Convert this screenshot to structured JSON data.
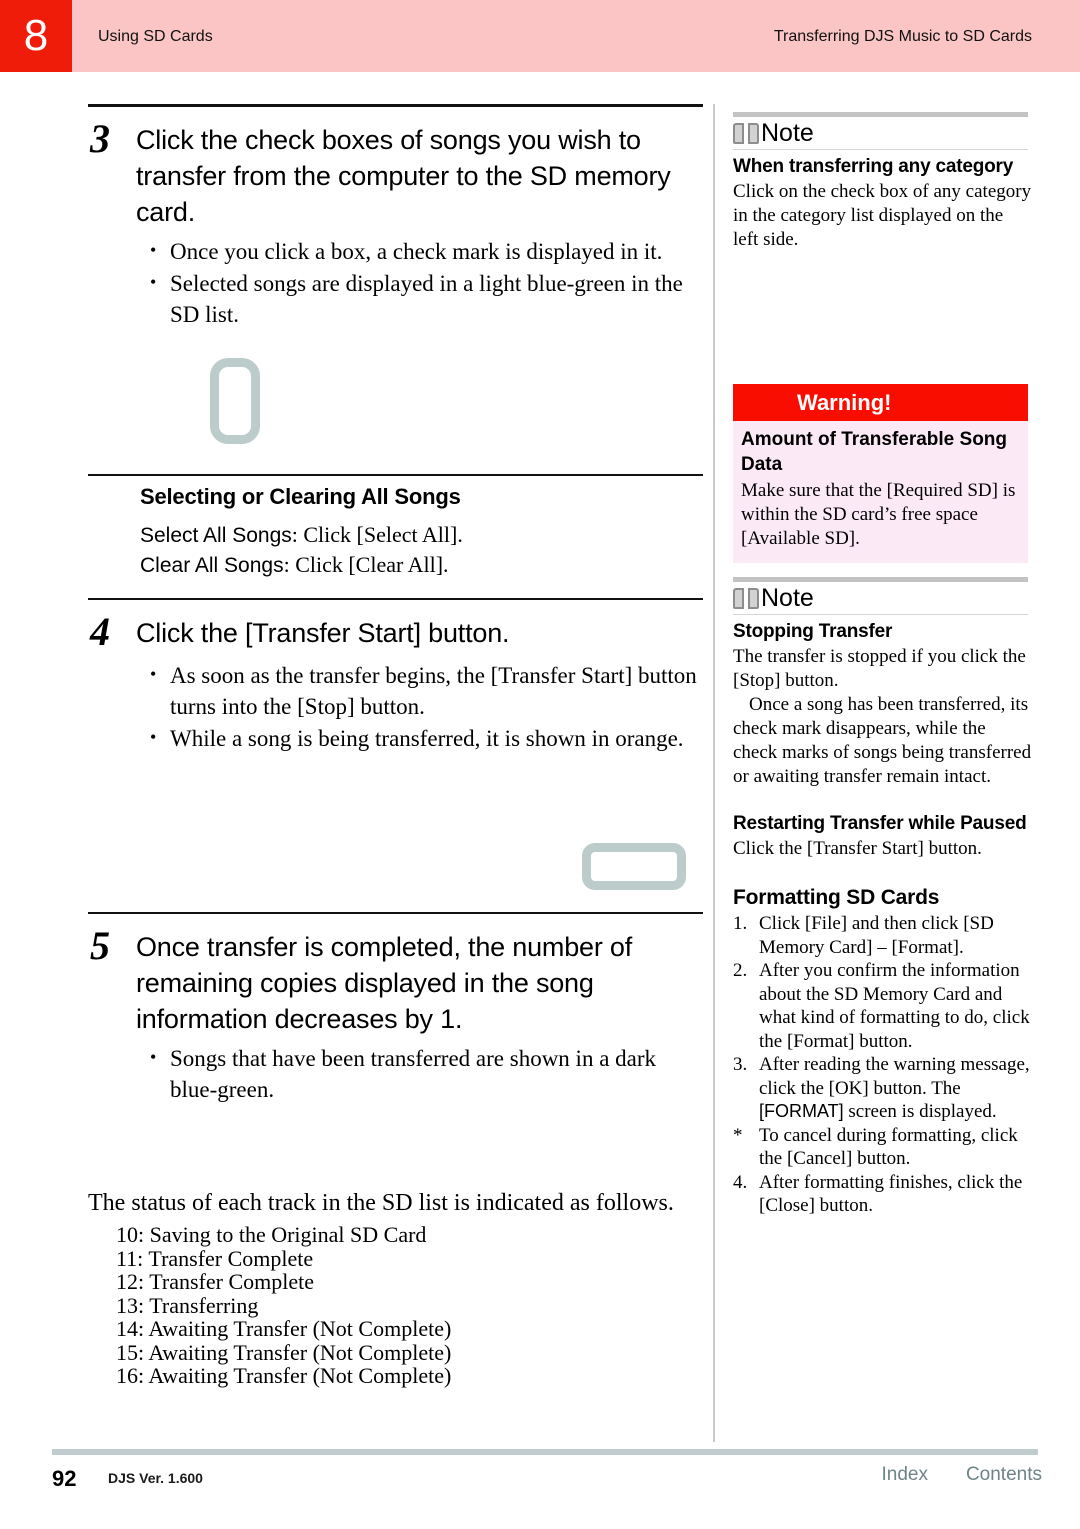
{
  "header": {
    "chapter_number": "8",
    "left_title": "Using SD Cards",
    "right_title": "Transferring DJS Music to SD Cards",
    "badge_color": "#f01c0a",
    "band_color": "#fac5c4"
  },
  "left_column": {
    "step3": {
      "number": "3",
      "title": "Click the check boxes of songs you wish to transfer from the computer to the SD memory card.",
      "bullets": [
        "Once you click a box, a check mark is displayed in it.",
        "Selected songs are displayed in a light blue-green in the SD list."
      ]
    },
    "selecting_section": {
      "heading": "Selecting or Clearing All Songs",
      "lines": [
        {
          "label": "Select All Songs",
          "text": ": Click [Select All]."
        },
        {
          "label": "Clear All Songs",
          "text": ": Click [Clear All]."
        }
      ]
    },
    "step4": {
      "number": "4",
      "title": "Click the [Transfer Start] button.",
      "bullets": [
        "As soon as the transfer begins, the [Transfer Start] button turns into the [Stop] button.",
        "While a song is being transferred, it is shown in orange."
      ]
    },
    "step5": {
      "number": "5",
      "title": "Once transfer is completed, the number of remaining copies displayed in the song information decreases by 1.",
      "bullets": [
        "Songs that have been transferred are shown in a dark blue-green."
      ]
    },
    "status_section": {
      "intro": "The status of each track in the SD list is indicated as follows.",
      "items": [
        "10: Saving to the Original SD Card",
        "11: Transfer Complete",
        "12: Transfer Complete",
        "13: Transferring",
        "14: Awaiting Transfer (Not Complete)",
        "15: Awaiting Transfer (Not Complete)",
        "16: Awaiting Transfer (Not Complete)"
      ]
    }
  },
  "right_column": {
    "note1": {
      "label": "Note",
      "heading": "When transferring any category",
      "body": "Click on the check box of any category in the category list displayed on the left side."
    },
    "warning": {
      "title": "Warning!",
      "heading": "Amount of Transferable Song Data",
      "body": "Make sure that the [Required SD] is within the SD card’s free space [Available SD].",
      "title_bg": "#f80d00",
      "body_bg": "#fce9f6"
    },
    "note2": {
      "label": "Note",
      "stopping": {
        "heading": "Stopping Transfer",
        "para1": "The transfer is stopped if you click the [Stop] button.",
        "para2": "Once a song has been transferred, its check mark disappears, while the check marks of songs being transferred or awaiting transfer remain intact."
      },
      "restarting": {
        "heading": "Restarting Transfer while Paused",
        "body": "Click the [Transfer Start] button."
      },
      "formatting": {
        "heading": "Formatting SD Cards",
        "items": [
          {
            "marker": "1.",
            "text_pre": "Click [File] and then click [SD Memory Card] – [Format].",
            "emphasis": "",
            "text_post": ""
          },
          {
            "marker": "2.",
            "text_pre": "After you confirm the information about the SD Memory Card and what kind of formatting to do, click the [Format] button.",
            "emphasis": "",
            "text_post": ""
          },
          {
            "marker": "3.",
            "text_pre": "After reading the warning message, click the [OK] button. The ",
            "emphasis": "[FORMAT]",
            "text_post": " screen is displayed."
          },
          {
            "marker": "*",
            "text_pre": "To cancel during formatting, click the [Cancel] button.",
            "emphasis": "",
            "text_post": ""
          },
          {
            "marker": "4.",
            "text_pre": "After formatting finishes, click the [Close] button.",
            "emphasis": "",
            "text_post": ""
          }
        ]
      }
    }
  },
  "footer": {
    "page_number": "92",
    "version": "DJS Ver. 1.600",
    "index_label": "Index",
    "contents_label": "Contents",
    "rule_color": "#bfcbcc",
    "link_color": "#6f8486"
  }
}
